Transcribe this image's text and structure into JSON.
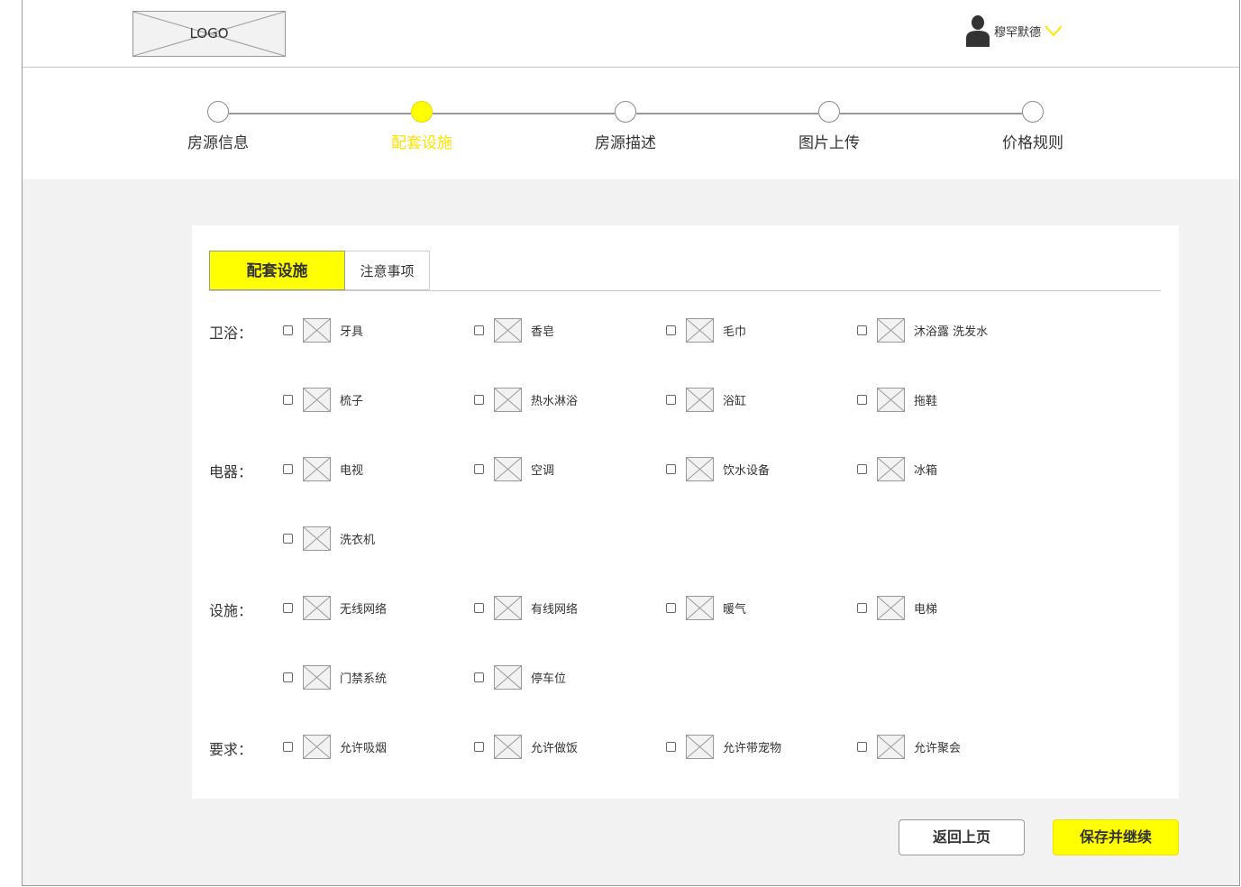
{
  "header": {
    "logo_text": "LOGO",
    "user_name": "穆罕默德",
    "accent_color": "#ffff00"
  },
  "steps": [
    {
      "label": "房源信息",
      "active": false
    },
    {
      "label": "配套设施",
      "active": true
    },
    {
      "label": "房源描述",
      "active": false
    },
    {
      "label": "图片上传",
      "active": false
    },
    {
      "label": "价格规则",
      "active": false
    }
  ],
  "tabs": [
    {
      "label": "配套设施",
      "active": true
    },
    {
      "label": "注意事项",
      "active": false
    }
  ],
  "categories": [
    {
      "label": "卫浴：",
      "rows": [
        [
          "牙具",
          "香皂",
          "毛巾",
          "沐浴露 洗发水"
        ],
        [
          "梳子",
          "热水淋浴",
          "浴缸",
          "拖鞋"
        ]
      ]
    },
    {
      "label": "电器：",
      "rows": [
        [
          "电视",
          "空调",
          "饮水设备",
          "冰箱"
        ],
        [
          "洗衣机"
        ]
      ]
    },
    {
      "label": "设施：",
      "rows": [
        [
          "无线网络",
          "有线网络",
          "暖气",
          "电梯"
        ],
        [
          "门禁系统",
          "停车位"
        ]
      ]
    },
    {
      "label": "要求：",
      "rows": [
        [
          "允许吸烟",
          "允许做饭",
          "允许带宠物",
          "允许聚会"
        ]
      ]
    }
  ],
  "buttons": {
    "back": "返回上页",
    "save": "保存并继续"
  },
  "icons": {
    "user": "user-icon",
    "dropdown": "chevron-down-icon",
    "placeholder": "image-placeholder-icon"
  }
}
